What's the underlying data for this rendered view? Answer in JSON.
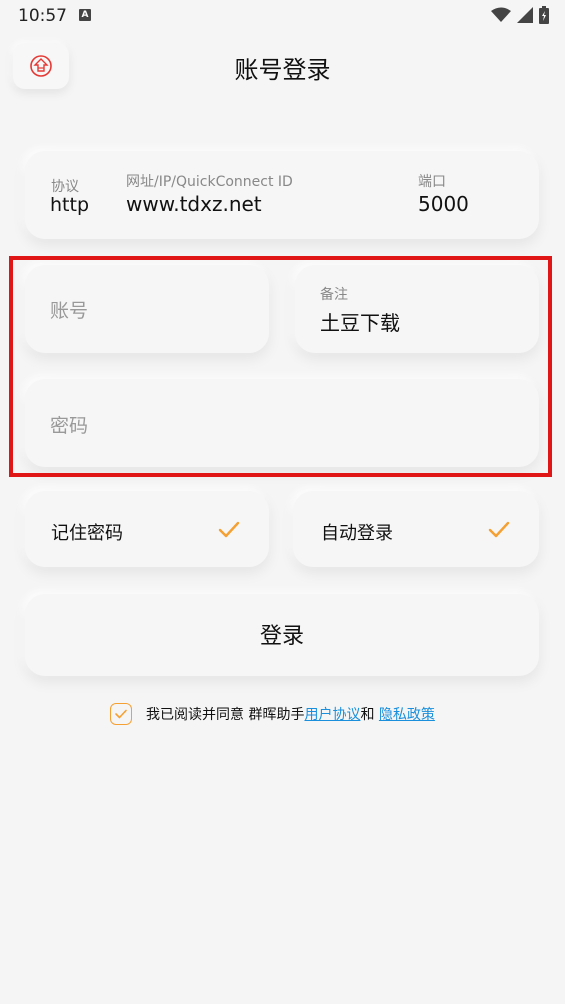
{
  "status_bar": {
    "time": "10:57",
    "notification_letter": "A"
  },
  "header": {
    "title": "账号登录"
  },
  "server": {
    "protocol_label": "协议",
    "protocol_value": "http",
    "address_label": "网址/IP/QuickConnect ID",
    "address_value": "www.tdxz.net",
    "port_label": "端口",
    "port_value": "5000"
  },
  "account": {
    "placeholder": "账号"
  },
  "remark": {
    "label": "备注",
    "value": "土豆下载"
  },
  "password": {
    "placeholder": "密码"
  },
  "options": {
    "remember_password": "记住密码",
    "auto_login": "自动登录"
  },
  "login_button": "登录",
  "agreement": {
    "prefix": "我已阅读并同意 群晖助手",
    "user_agreement": "用户协议",
    "and": "和 ",
    "privacy_policy": "隐私政策"
  },
  "colors": {
    "accent": "#f5a032",
    "link": "#1a8fdc",
    "highlight": "#e01616"
  }
}
